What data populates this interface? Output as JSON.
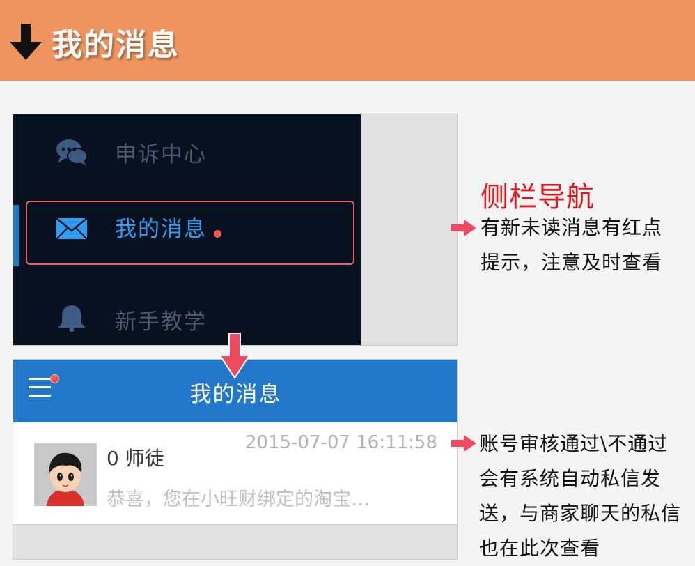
{
  "header": {
    "title": "我的消息",
    "icon": "arrow-down-icon"
  },
  "sidebar": {
    "items": [
      {
        "label": "申诉中心",
        "icon": "chat-bubbles-icon"
      },
      {
        "label": "我的消息",
        "icon": "envelope-icon",
        "active": true,
        "unread": true
      },
      {
        "label": "新手教学",
        "icon": "bell-icon"
      }
    ]
  },
  "messages": {
    "header_title": "我的消息",
    "items": [
      {
        "sender": "0 师徒",
        "time": "2015-07-07 16:11:58",
        "preview": "恭喜，您在小旺财绑定的淘宝…"
      }
    ]
  },
  "annotations": {
    "sidebar_title": "侧栏导航",
    "sidebar_lines": [
      "有新未读消息有红点",
      "提示，注意及时查看"
    ],
    "message_lines": [
      "账号审核通过\\不通过",
      "会有系统自动私信发",
      "送，与商家聊天的私信",
      "也在此次查看"
    ]
  },
  "colors": {
    "banner": "#f0945f",
    "sidebar_bg": "#07111f",
    "accent_blue": "#2377c8",
    "highlight_red": "#e85e63",
    "annotation_red": "#e5161b",
    "arrow_pink": "#f04a60"
  }
}
